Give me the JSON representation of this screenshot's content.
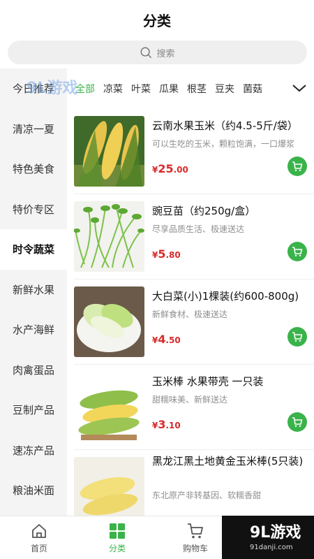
{
  "header": {
    "title": "分类"
  },
  "search": {
    "placeholder": "搜索"
  },
  "sidebar": {
    "items": [
      {
        "label": "今日推荐"
      },
      {
        "label": "清凉一夏"
      },
      {
        "label": "特色美食"
      },
      {
        "label": "特价专区"
      },
      {
        "label": "时令蔬菜",
        "active": true
      },
      {
        "label": "新鲜水果"
      },
      {
        "label": "水产海鲜"
      },
      {
        "label": "肉禽蛋品"
      },
      {
        "label": "豆制产品"
      },
      {
        "label": "速冻产品"
      },
      {
        "label": "粮油米面"
      }
    ]
  },
  "subtabs": {
    "items": [
      {
        "label": "全部",
        "active": true
      },
      {
        "label": "凉菜"
      },
      {
        "label": "叶菜"
      },
      {
        "label": "瓜果"
      },
      {
        "label": "根茎"
      },
      {
        "label": "豆夹"
      },
      {
        "label": "菌菇"
      }
    ]
  },
  "products": [
    {
      "name": "云南水果玉米（约4.5-5斤/袋）",
      "desc": "可以生吃的玉米，颗粒饱满，一口爆浆",
      "currency": "¥",
      "price_int": "25",
      "price_dec": ".00"
    },
    {
      "name": "豌豆苗（约250g/盒）",
      "desc": "尽享品质生活、极速送达",
      "currency": "¥",
      "price_int": "5",
      "price_dec": ".80"
    },
    {
      "name": "大白菜(小)1棵装(约600-800g)",
      "desc": "新鲜食材、极速送达",
      "currency": "¥",
      "price_int": "4",
      "price_dec": ".50"
    },
    {
      "name": "玉米棒 水果带壳 一只装",
      "desc": "甜糯味美、新鲜送达",
      "currency": "¥",
      "price_int": "3",
      "price_dec": ".10"
    },
    {
      "name": "黑龙江黑土地黄金玉米棒(5只装)",
      "desc": "东北原产非转基因、软糯香甜",
      "currency": "",
      "price_int": "",
      "price_dec": ""
    }
  ],
  "tabbar": {
    "items": [
      {
        "label": "首页",
        "icon": "home-icon"
      },
      {
        "label": "分类",
        "icon": "category-icon",
        "active": true
      },
      {
        "label": "购物车",
        "icon": "cart-icon"
      }
    ]
  },
  "watermark": {
    "text": "9L游戏",
    "url": "91danji.com"
  },
  "colors": {
    "accent": "#3ab34a",
    "price": "#d92a2a",
    "sidebar_bg": "#f4f4f4"
  }
}
